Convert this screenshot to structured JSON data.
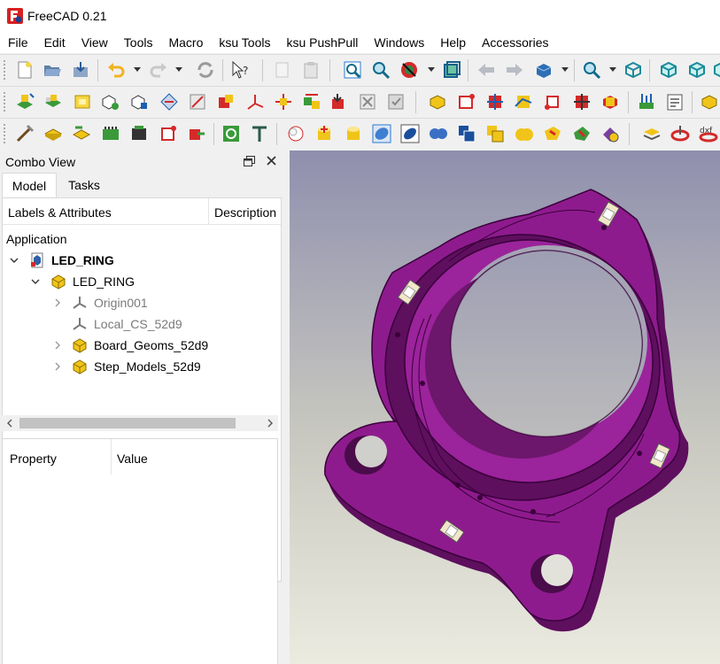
{
  "window": {
    "title": "FreeCAD 0.21"
  },
  "menu": [
    "File",
    "Edit",
    "View",
    "Tools",
    "Macro",
    "ksu Tools",
    "ksu PushPull",
    "Windows",
    "Help",
    "Accessories"
  ],
  "toolbars": {
    "row1": [
      "new-document-icon",
      "open-icon",
      "save-icon",
      "undo-icon",
      "redo-icon",
      "refresh-icon",
      "whats-this-icon",
      "cut-icon",
      "paste-icon",
      "fit-all-icon",
      "fit-selection-icon",
      "draw-style-icon",
      "bounding-box-icon",
      "back-icon",
      "forward-icon",
      "std-views-icon",
      "zoom-icon",
      "axonometric-icon",
      "front-view-icon",
      "top-view-icon"
    ],
    "row2": [
      "ksu-load-board-icon",
      "ksu-import-icon",
      "ksu-footprint-icon",
      "ksu-model-icon",
      "ksu-align-icon",
      "ksu-place-icon",
      "ksu-config-icon",
      "ksu-export-icon",
      "ksu-axis-icon",
      "ksu-move-icon",
      "ksu-sync-icon",
      "ksu-push-icon",
      "ksu-pull-icon",
      "ksu-check-icon"
    ],
    "row3": [
      "ksu-tools-icon",
      "ksu-box-icon",
      "ksu-step-icon",
      "ksu-pcb-icon",
      "ksu-layers-icon",
      "ksu-sketch-icon",
      "ksu-edge-icon",
      "ksu-fillet-icon",
      "ksu-circle-icon",
      "ksu-cylinder-icon",
      "ksu-cylinder2-icon",
      "ksu-sphere-icon",
      "ksu-union-icon",
      "ksu-cube-icon",
      "ksu-cube2-icon",
      "ksu-cone-icon",
      "ksu-shape-icon",
      "ksu-dxf-icon"
    ]
  },
  "combo_view": {
    "title": "Combo View",
    "tabs": [
      "Model",
      "Tasks"
    ],
    "active_tab": "Model",
    "tree_columns": [
      "Labels & Attributes",
      "Description"
    ],
    "tree_section": "Application",
    "tree": [
      {
        "label": "LED_RING",
        "icon": "document-icon",
        "depth": 0,
        "expanded": true,
        "style": "bold"
      },
      {
        "label": "LED_RING",
        "icon": "part-icon",
        "depth": 1,
        "expanded": true,
        "style": "normal"
      },
      {
        "label": "Origin001",
        "icon": "origin-icon",
        "depth": 2,
        "expanded": false,
        "style": "grey"
      },
      {
        "label": "Local_CS_52d9",
        "icon": "coordinate-system-icon",
        "depth": 2,
        "expanded": null,
        "style": "grey"
      },
      {
        "label": "Board_Geoms_52d9",
        "icon": "part-icon",
        "depth": 2,
        "expanded": false,
        "style": "normal"
      },
      {
        "label": "Step_Models_52d9",
        "icon": "part-icon",
        "depth": 2,
        "expanded": false,
        "style": "normal"
      }
    ],
    "property_columns": [
      "Property",
      "Value"
    ]
  },
  "viewport": {
    "model_color": "#8e1b8e",
    "bg_top": "#8f8fae",
    "bg_bottom": "#ebebe0"
  }
}
